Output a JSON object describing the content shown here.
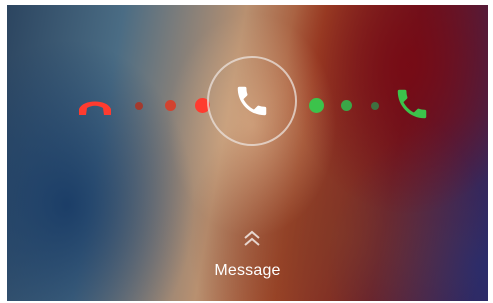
{
  "incoming_call": {
    "decline_icon": "decline-call-icon",
    "answer_icon": "answer-call-icon",
    "center_icon": "phone-icon",
    "swipe_up_icon": "double-chevron-up-icon",
    "message_label": "Message"
  },
  "colors": {
    "decline": "#ff3b2f",
    "answer": "#3cc34b",
    "ring": "#ebe1dc"
  }
}
